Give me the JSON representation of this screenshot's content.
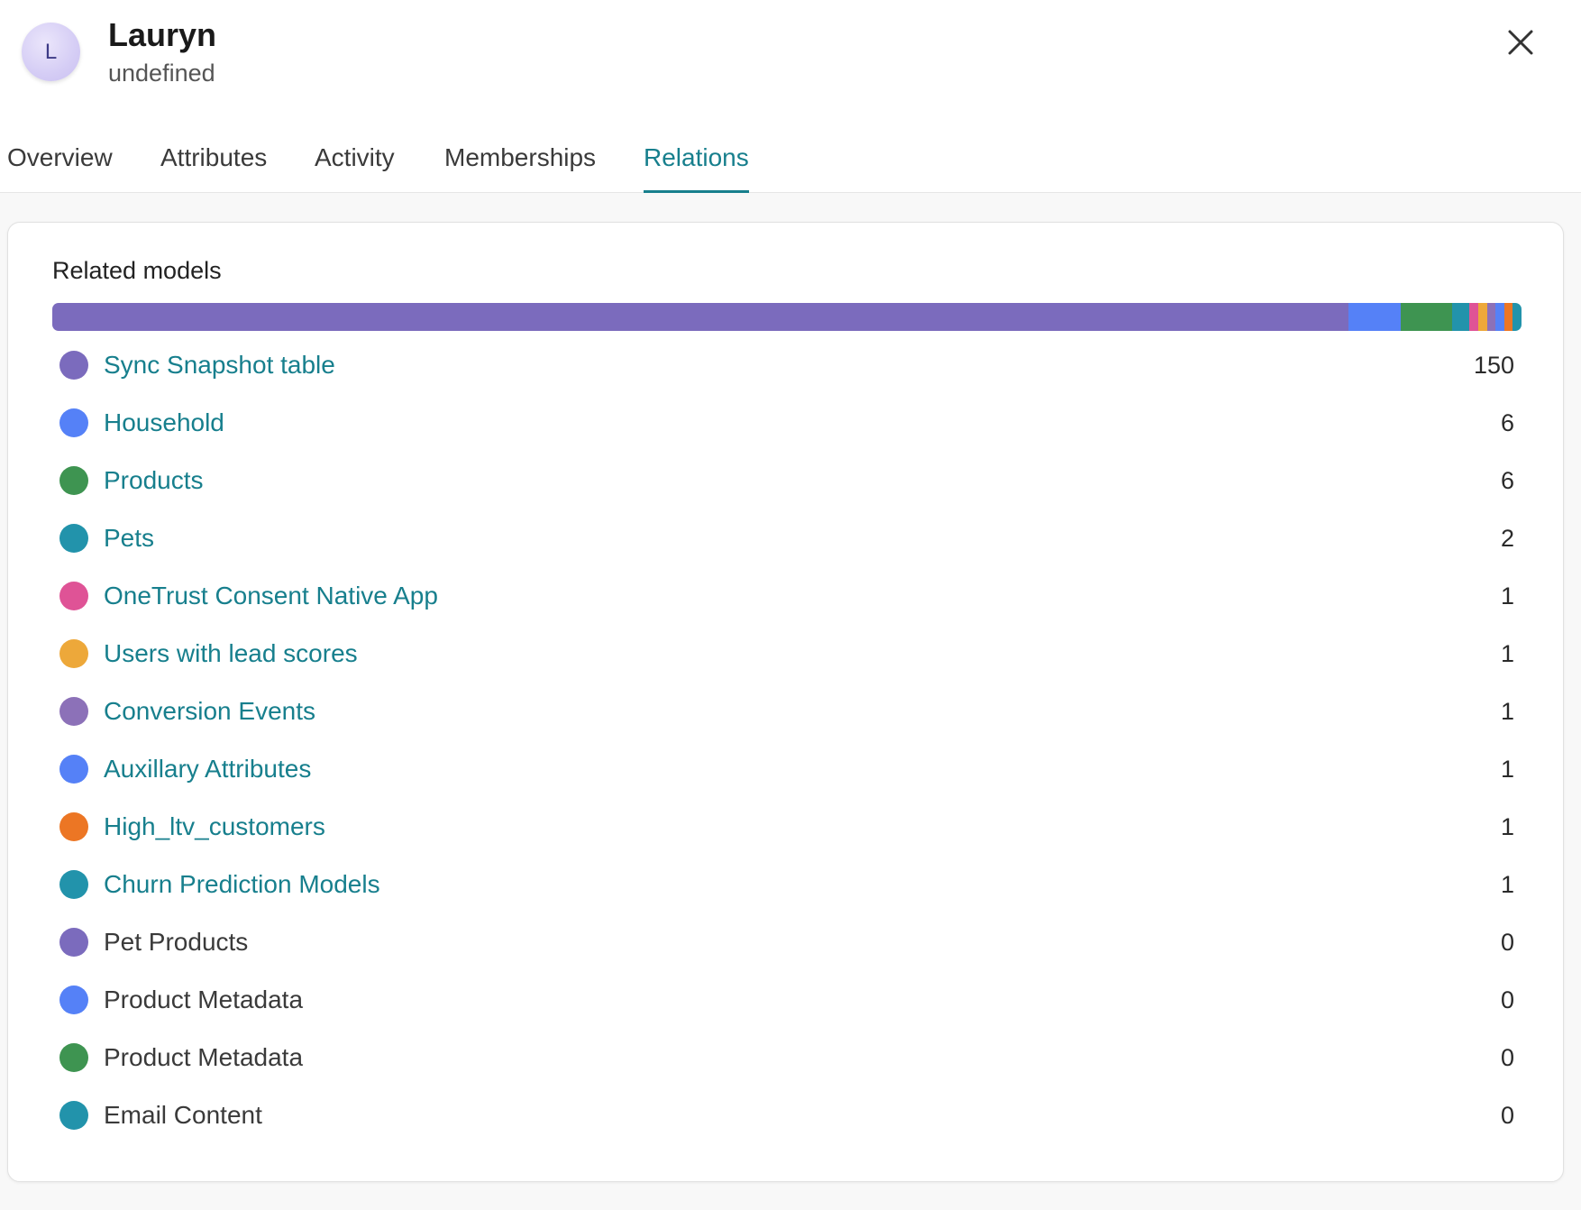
{
  "user": {
    "initial": "L",
    "name": "Lauryn",
    "subtitle": "undefined"
  },
  "tabs": [
    {
      "label": "Overview",
      "active": false
    },
    {
      "label": "Attributes",
      "active": false
    },
    {
      "label": "Activity",
      "active": false
    },
    {
      "label": "Memberships",
      "active": false
    },
    {
      "label": "Relations",
      "active": true
    }
  ],
  "card": {
    "title": "Related models"
  },
  "models": [
    {
      "label": "Sync Snapshot table",
      "count": "150",
      "color": "#7b6bbd",
      "link": true
    },
    {
      "label": "Household",
      "count": "6",
      "color": "#5581f7",
      "link": true
    },
    {
      "label": "Products",
      "count": "6",
      "color": "#3e9451",
      "link": true
    },
    {
      "label": "Pets",
      "count": "2",
      "color": "#2293ab",
      "link": true
    },
    {
      "label": "OneTrust Consent Native App",
      "count": "1",
      "color": "#df5396",
      "link": true
    },
    {
      "label": "Users with lead scores",
      "count": "1",
      "color": "#eda83a",
      "link": true
    },
    {
      "label": "Conversion Events",
      "count": "1",
      "color": "#8c71b8",
      "link": true
    },
    {
      "label": "Auxillary Attributes",
      "count": "1",
      "color": "#5581f7",
      "link": true
    },
    {
      "label": "High_ltv_customers",
      "count": "1",
      "color": "#ec7624",
      "link": true
    },
    {
      "label": "Churn Prediction Models",
      "count": "1",
      "color": "#2293ab",
      "link": true
    },
    {
      "label": "Pet Products",
      "count": "0",
      "color": "#7b6bbd",
      "link": false
    },
    {
      "label": "Product Metadata",
      "count": "0",
      "color": "#5581f7",
      "link": false
    },
    {
      "label": "Product Metadata",
      "count": "0",
      "color": "#3e9451",
      "link": false
    },
    {
      "label": "Email Content",
      "count": "0",
      "color": "#2293ab",
      "link": false
    }
  ]
}
